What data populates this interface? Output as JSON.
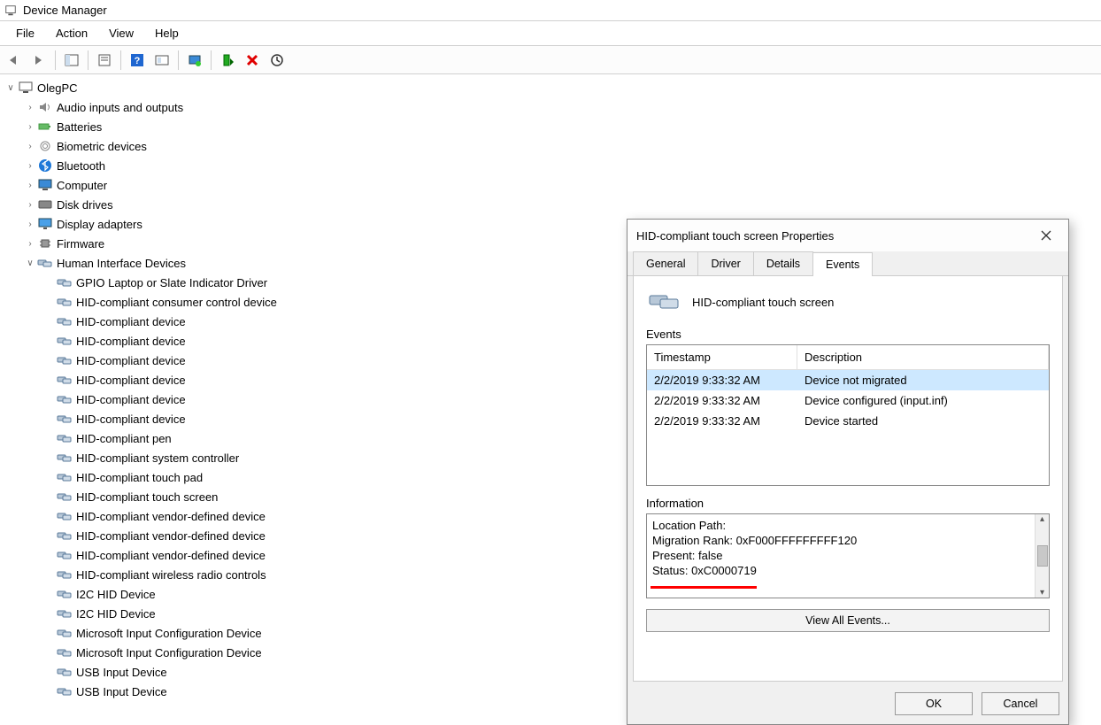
{
  "window": {
    "title": "Device Manager"
  },
  "menu": {
    "file": "File",
    "action": "Action",
    "view": "View",
    "help": "Help"
  },
  "tree": {
    "root": "OlegPC",
    "categories": [
      {
        "label": "Audio inputs and outputs",
        "icon": "speaker"
      },
      {
        "label": "Batteries",
        "icon": "battery"
      },
      {
        "label": "Biometric devices",
        "icon": "fingerprint"
      },
      {
        "label": "Bluetooth",
        "icon": "bluetooth"
      },
      {
        "label": "Computer",
        "icon": "monitor"
      },
      {
        "label": "Disk drives",
        "icon": "disk"
      },
      {
        "label": "Display adapters",
        "icon": "display"
      },
      {
        "label": "Firmware",
        "icon": "chip"
      },
      {
        "label": "Human Interface Devices",
        "icon": "hid",
        "expanded": true
      }
    ],
    "hid_children": [
      "GPIO Laptop or Slate Indicator Driver",
      "HID-compliant consumer control device",
      "HID-compliant device",
      "HID-compliant device",
      "HID-compliant device",
      "HID-compliant device",
      "HID-compliant device",
      "HID-compliant device",
      "HID-compliant pen",
      "HID-compliant system controller",
      "HID-compliant touch pad",
      "HID-compliant touch screen",
      "HID-compliant vendor-defined device",
      "HID-compliant vendor-defined device",
      "HID-compliant vendor-defined device",
      "HID-compliant wireless radio controls",
      "I2C HID Device",
      "I2C HID Device",
      "Microsoft Input Configuration Device",
      "Microsoft Input Configuration Device",
      "USB Input Device",
      "USB Input Device"
    ]
  },
  "dialog": {
    "title": "HID-compliant touch screen Properties",
    "tabs": {
      "general": "General",
      "driver": "Driver",
      "details": "Details",
      "events": "Events"
    },
    "device_name": "HID-compliant touch screen",
    "events_label": "Events",
    "cols": {
      "timestamp": "Timestamp",
      "description": "Description"
    },
    "rows": [
      {
        "ts": "2/2/2019 9:33:32 AM",
        "desc": "Device not migrated",
        "selected": true
      },
      {
        "ts": "2/2/2019 9:33:32 AM",
        "desc": "Device configured (input.inf)"
      },
      {
        "ts": "2/2/2019 9:33:32 AM",
        "desc": "Device started"
      }
    ],
    "info_label": "Information",
    "info_text": "Location Path:\nMigration Rank: 0xF000FFFFFFFFF120\nPresent: false\nStatus: 0xC0000719",
    "view_all": "View All Events...",
    "ok": "OK",
    "cancel": "Cancel"
  }
}
